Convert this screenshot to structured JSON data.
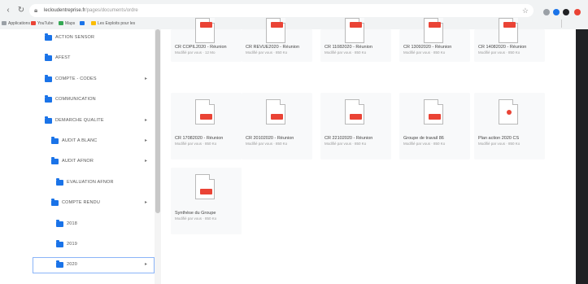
{
  "browser": {
    "url_host": "lecloudentreprise.fr",
    "url_path": "/pages/documents/ordre",
    "bookmarks": [
      {
        "label": "Applications",
        "color": "#9aa0a6"
      },
      {
        "label": "YouTube",
        "color": "#ea4335"
      },
      {
        "label": "Maps",
        "color": "#34a853"
      },
      {
        "label": "",
        "color": "#1a73e8"
      },
      {
        "label": "Les Exploits pour les",
        "color": "#fbbc04"
      }
    ],
    "extensions": [
      "#9aa0a6",
      "#1a73e8",
      "#202124",
      "#ea4335"
    ]
  },
  "sidebar": {
    "items": [
      {
        "label": "ACTION SENSOR",
        "indent": 1
      },
      {
        "label": "AFEST",
        "indent": 1
      },
      {
        "label": "COMPTE - CODES",
        "indent": 1,
        "expandable": true
      },
      {
        "label": "COMMUNICATION",
        "indent": 1
      },
      {
        "label": "DEMARCHE QUALITE",
        "indent": 1,
        "expandable": true
      },
      {
        "label": "AUDIT A BLANC",
        "indent": 2,
        "expandable": true
      },
      {
        "label": "AUDIT AFNOR",
        "indent": 2,
        "expandable": true
      },
      {
        "label": "EVALUATION AFNOR",
        "indent": 3
      },
      {
        "label": "COMPTE RENDU",
        "indent": 2,
        "expandable": true
      },
      {
        "label": "2018",
        "indent": 3
      },
      {
        "label": "2019",
        "indent": 3
      },
      {
        "label": "2020",
        "indent": 3,
        "expandable": true,
        "selected": true
      }
    ]
  },
  "files": [
    {
      "name": "CR COPIL2020 - Réunion",
      "meta": "Modifié par vous · 12 Mo",
      "type": "pdf"
    },
    {
      "name": "CR REVUE2020 - Réunion",
      "meta": "Modifié par vous · 850 Ko",
      "type": "pdf"
    },
    {
      "name": "CR 11082020 - Réunion",
      "meta": "Modifié par vous · 850 Ko",
      "type": "pdf"
    },
    {
      "name": "CR 13092020 - Réunion",
      "meta": "Modifié par vous · 850 Ko",
      "type": "pdf"
    },
    {
      "name": "CR 14082020 - Réunion",
      "meta": "Modifié par vous · 850 Ko",
      "type": "pdf"
    },
    {
      "name": "CR 17082020 - Réunion",
      "meta": "Modifié par vous · 850 Ko",
      "type": "pdf"
    },
    {
      "name": "CR 20102020 - Réunion",
      "meta": "Modifié par vous · 850 Ko",
      "type": "pdf"
    },
    {
      "name": "CR 22102020 - Réunion",
      "meta": "Modifié par vous · 850 Ko",
      "type": "pdf"
    },
    {
      "name": "Groupe de travail 86",
      "meta": "Modifié par vous · 850 Ko",
      "type": "pdf"
    },
    {
      "name": "Plan action 2020 CS",
      "meta": "Modifié par vous · 850 Ko",
      "type": "pdf-round"
    },
    {
      "name": "Synthèse du Groupe",
      "meta": "Modifié par vous · 850 Ko",
      "type": "pdf"
    }
  ]
}
